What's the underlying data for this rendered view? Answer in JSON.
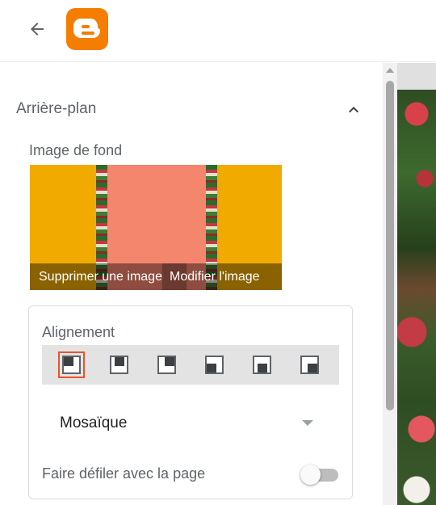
{
  "header": {
    "back_icon": "arrow-left-icon",
    "logo_icon": "blogger-logo-icon",
    "brand_color": "#f57d00"
  },
  "panel": {
    "section_title": "Arrière-plan",
    "section_state": "expanded",
    "background_image": {
      "label": "Image de fond",
      "remove_label": "Supprimer une image",
      "edit_label": "Modifier l'image",
      "preview_colors": [
        "#f0aa00",
        "#f4866e"
      ]
    },
    "alignment": {
      "label": "Alignement",
      "options": [
        "top-left",
        "top-center",
        "top-right",
        "bottom-left",
        "bottom-center",
        "bottom-right"
      ],
      "selected_index": 0,
      "selected_color": "#e8542b"
    },
    "repeat_select": {
      "value": "Mosaïque"
    },
    "scroll_with_page": {
      "label": "Faire défiler avec la page",
      "on": false
    }
  }
}
